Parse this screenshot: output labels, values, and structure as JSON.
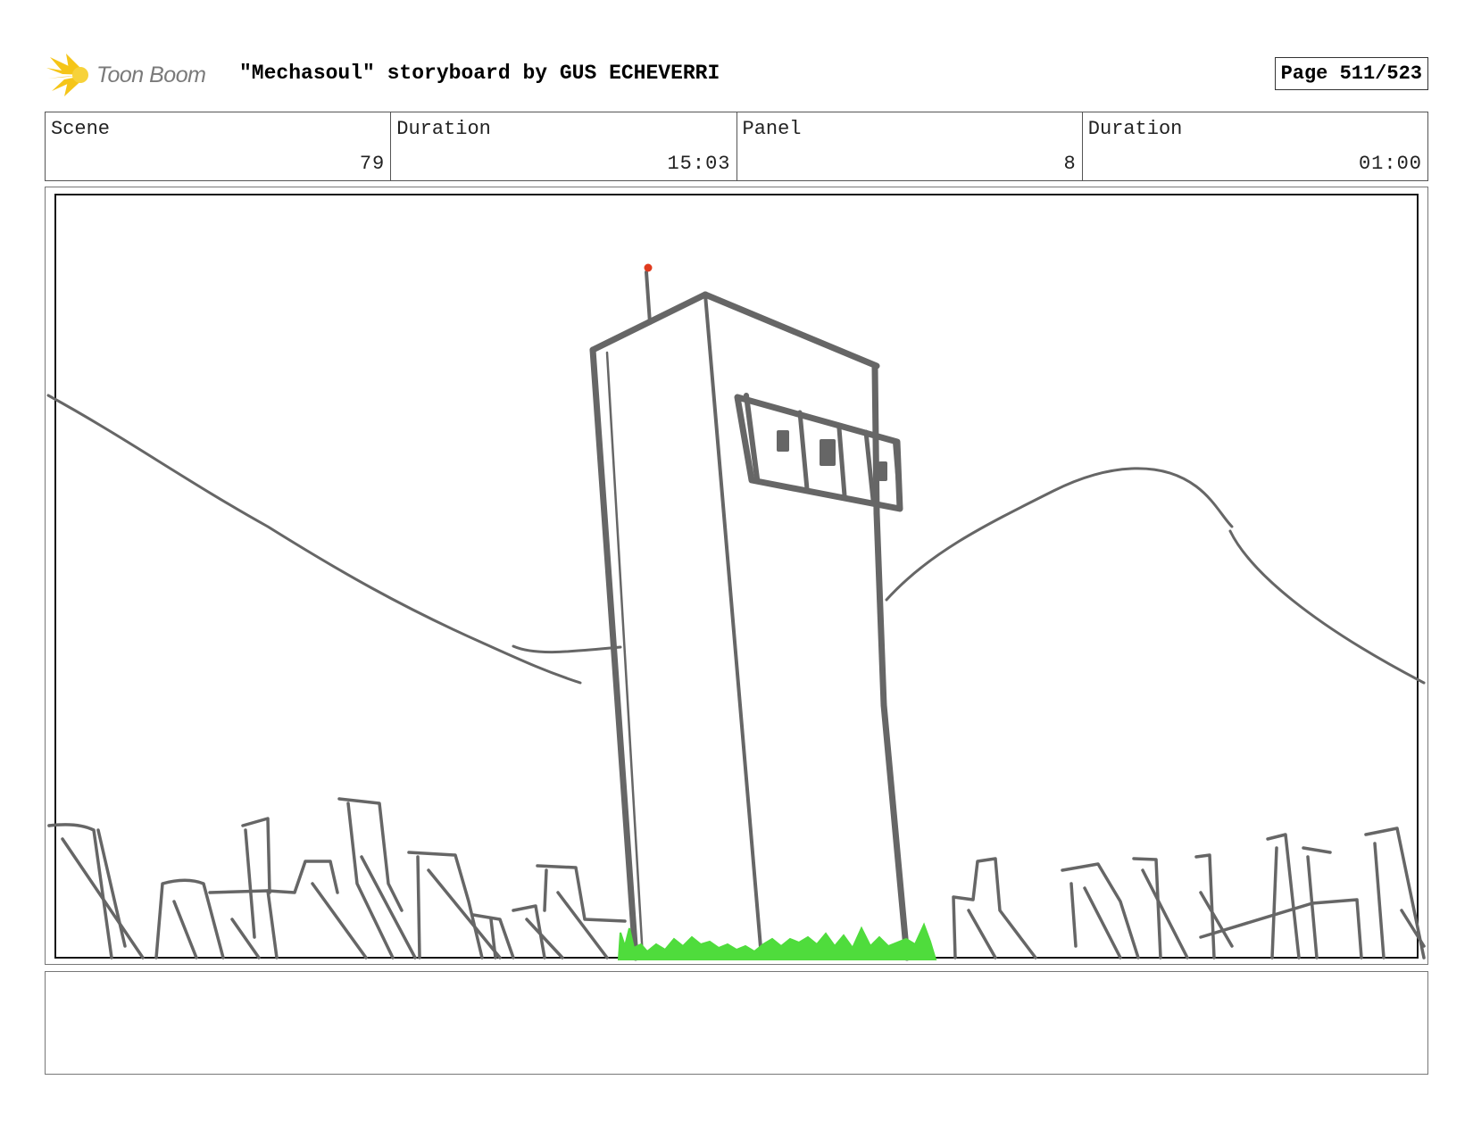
{
  "header": {
    "brand_text": "Toon Boom",
    "title": "\"Mechasoul\" storyboard by GUS ECHEVERRI",
    "page_label": "Page 511/523"
  },
  "info": {
    "scene_label": "Scene",
    "scene_value": "79",
    "scene_duration_label": "Duration",
    "scene_duration_value": "15:03",
    "panel_label": "Panel",
    "panel_value": "8",
    "panel_duration_label": "Duration",
    "panel_duration_value": "01:00"
  },
  "panel": {
    "subject": "tower sketch with hills and rocks",
    "colors": {
      "line": "#666666",
      "grass": "#4fdc3c",
      "beacon": "#e03a1e",
      "logo": "#f5c518"
    }
  },
  "notes": {
    "text": ""
  }
}
